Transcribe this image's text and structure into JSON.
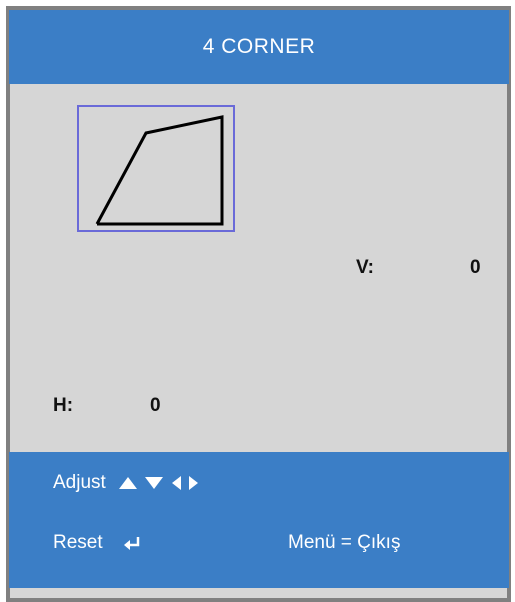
{
  "header": {
    "title": "4 CORNER"
  },
  "preview": {
    "shape": "keystone-quadrilateral"
  },
  "vertical": {
    "label": "V:",
    "value": "0"
  },
  "horizontal": {
    "label": "H:",
    "value": "0"
  },
  "footer": {
    "adjust_label": "Adjust",
    "adjust_icons": [
      "up-arrow-icon",
      "down-arrow-icon",
      "left-arrow-icon",
      "right-arrow-icon"
    ],
    "reset_label": "Reset",
    "reset_icon": "enter-icon",
    "menu_exit_label": "Menü = Çıkış"
  },
  "colors": {
    "header_bg": "#3b7ec6",
    "panel_bg": "#d6d6d6",
    "frame_border": "#808080",
    "preview_border": "#6a6ad8"
  }
}
